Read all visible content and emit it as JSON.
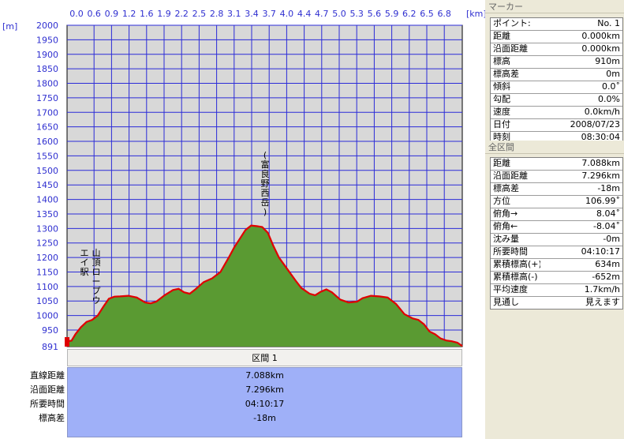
{
  "chart_data": {
    "type": "area",
    "x_unit": "[km]",
    "y_unit": "[m]",
    "x_ticks": [
      "0.0",
      "0.6",
      "0.9",
      "1.2",
      "1.6",
      "1.9",
      "2.2",
      "2.5",
      "2.8",
      "3.1",
      "3.4",
      "3.7",
      "4.0",
      "4.4",
      "4.7",
      "5.0",
      "5.3",
      "5.6",
      "5.9",
      "6.2",
      "6.5",
      "6.8"
    ],
    "y_ticks": [
      "2000",
      "1950",
      "1900",
      "1850",
      "1800",
      "1750",
      "1700",
      "1650",
      "1600",
      "1550",
      "1500",
      "1450",
      "1400",
      "1350",
      "1300",
      "1250",
      "1200",
      "1150",
      "1100",
      "1050",
      "1000",
      "950"
    ],
    "y_min_label": "891",
    "ylim": [
      891,
      2000
    ],
    "xlim": [
      0,
      7.088
    ],
    "grid": true,
    "annotations": [
      {
        "text": "山頂ロープウエイ駅",
        "km": 0.45,
        "elev": 1080
      },
      {
        "text": "(富良野西岳)",
        "km": 3.5,
        "elev": 1320
      }
    ],
    "series": [
      {
        "x": [
          0.0,
          0.08,
          0.15,
          0.25,
          0.35,
          0.45,
          0.55,
          0.65,
          0.75,
          0.85,
          0.95,
          1.1,
          1.25,
          1.4,
          1.5,
          1.6,
          1.75,
          1.9,
          2.0,
          2.1,
          2.2,
          2.3,
          2.45,
          2.6,
          2.75,
          2.9,
          3.0,
          3.1,
          3.2,
          3.3,
          3.4,
          3.5,
          3.6,
          3.7,
          3.8,
          3.95,
          4.1,
          4.2,
          4.35,
          4.45,
          4.55,
          4.65,
          4.75,
          4.9,
          5.05,
          5.2,
          5.3,
          5.45,
          5.6,
          5.75,
          5.9,
          6.05,
          6.2,
          6.3,
          6.4,
          6.5,
          6.6,
          6.7,
          6.8,
          6.9,
          7.0,
          7.088
        ],
        "y": [
          910,
          912,
          935,
          960,
          978,
          985,
          1000,
          1030,
          1058,
          1065,
          1066,
          1068,
          1062,
          1045,
          1042,
          1048,
          1070,
          1088,
          1092,
          1080,
          1075,
          1090,
          1115,
          1128,
          1150,
          1200,
          1235,
          1265,
          1295,
          1310,
          1308,
          1305,
          1285,
          1240,
          1200,
          1160,
          1120,
          1095,
          1075,
          1070,
          1082,
          1090,
          1080,
          1055,
          1045,
          1048,
          1060,
          1068,
          1066,
          1062,
          1040,
          1005,
          990,
          985,
          970,
          945,
          935,
          920,
          913,
          910,
          905,
          893
        ]
      }
    ]
  },
  "marker_panel": {
    "title": "マーカー",
    "rows": [
      {
        "label": "ポイント:",
        "value": "No. 1"
      },
      {
        "label": "距離",
        "value": "0.000km"
      },
      {
        "label": "沿面距離",
        "value": "0.000km"
      },
      {
        "label": "標高",
        "value": "910m"
      },
      {
        "label": "標高差",
        "value": "0m"
      },
      {
        "label": "傾斜",
        "value": "0.0˚"
      },
      {
        "label": "勾配",
        "value": "0.0%"
      },
      {
        "label": "速度",
        "value": "0.0km/h"
      },
      {
        "label": "日付",
        "value": "2008/07/23"
      },
      {
        "label": "時刻",
        "value": "08:30:04"
      }
    ]
  },
  "section_panel": {
    "title": "全区間",
    "rows": [
      {
        "label": "距離",
        "value": "7.088km"
      },
      {
        "label": "沿面距離",
        "value": "7.296km"
      },
      {
        "label": "標高差",
        "value": "-18m"
      },
      {
        "label": "方位",
        "value": "106.99˚"
      },
      {
        "label": "俯角→",
        "value": "8.04˚"
      },
      {
        "label": "俯角←",
        "value": "-8.04˚"
      },
      {
        "label": "沈み量",
        "value": "-0m"
      },
      {
        "label": "所要時間",
        "value": "04:10:17"
      },
      {
        "label": "累積標高(+)",
        "value": "634m"
      },
      {
        "label": "累積標高(-)",
        "value": "-652m"
      },
      {
        "label": "平均速度",
        "value": "1.7km/h"
      },
      {
        "label": "見通し",
        "value": "見えます"
      }
    ]
  },
  "summary": {
    "header": "区間 1",
    "rows": [
      {
        "label": "直線距離",
        "value": "7.088km"
      },
      {
        "label": "沿面距離",
        "value": "7.296km"
      },
      {
        "label": "所要時間",
        "value": "04:10:17"
      },
      {
        "label": "標高差",
        "value": "-18m"
      }
    ]
  },
  "colors": {
    "plot_bg": "#d8d8d8",
    "grid": "#2b2bd8",
    "fill": "#5a9a32",
    "line": "#e00000",
    "summary_bg": "#9fb0f8"
  }
}
